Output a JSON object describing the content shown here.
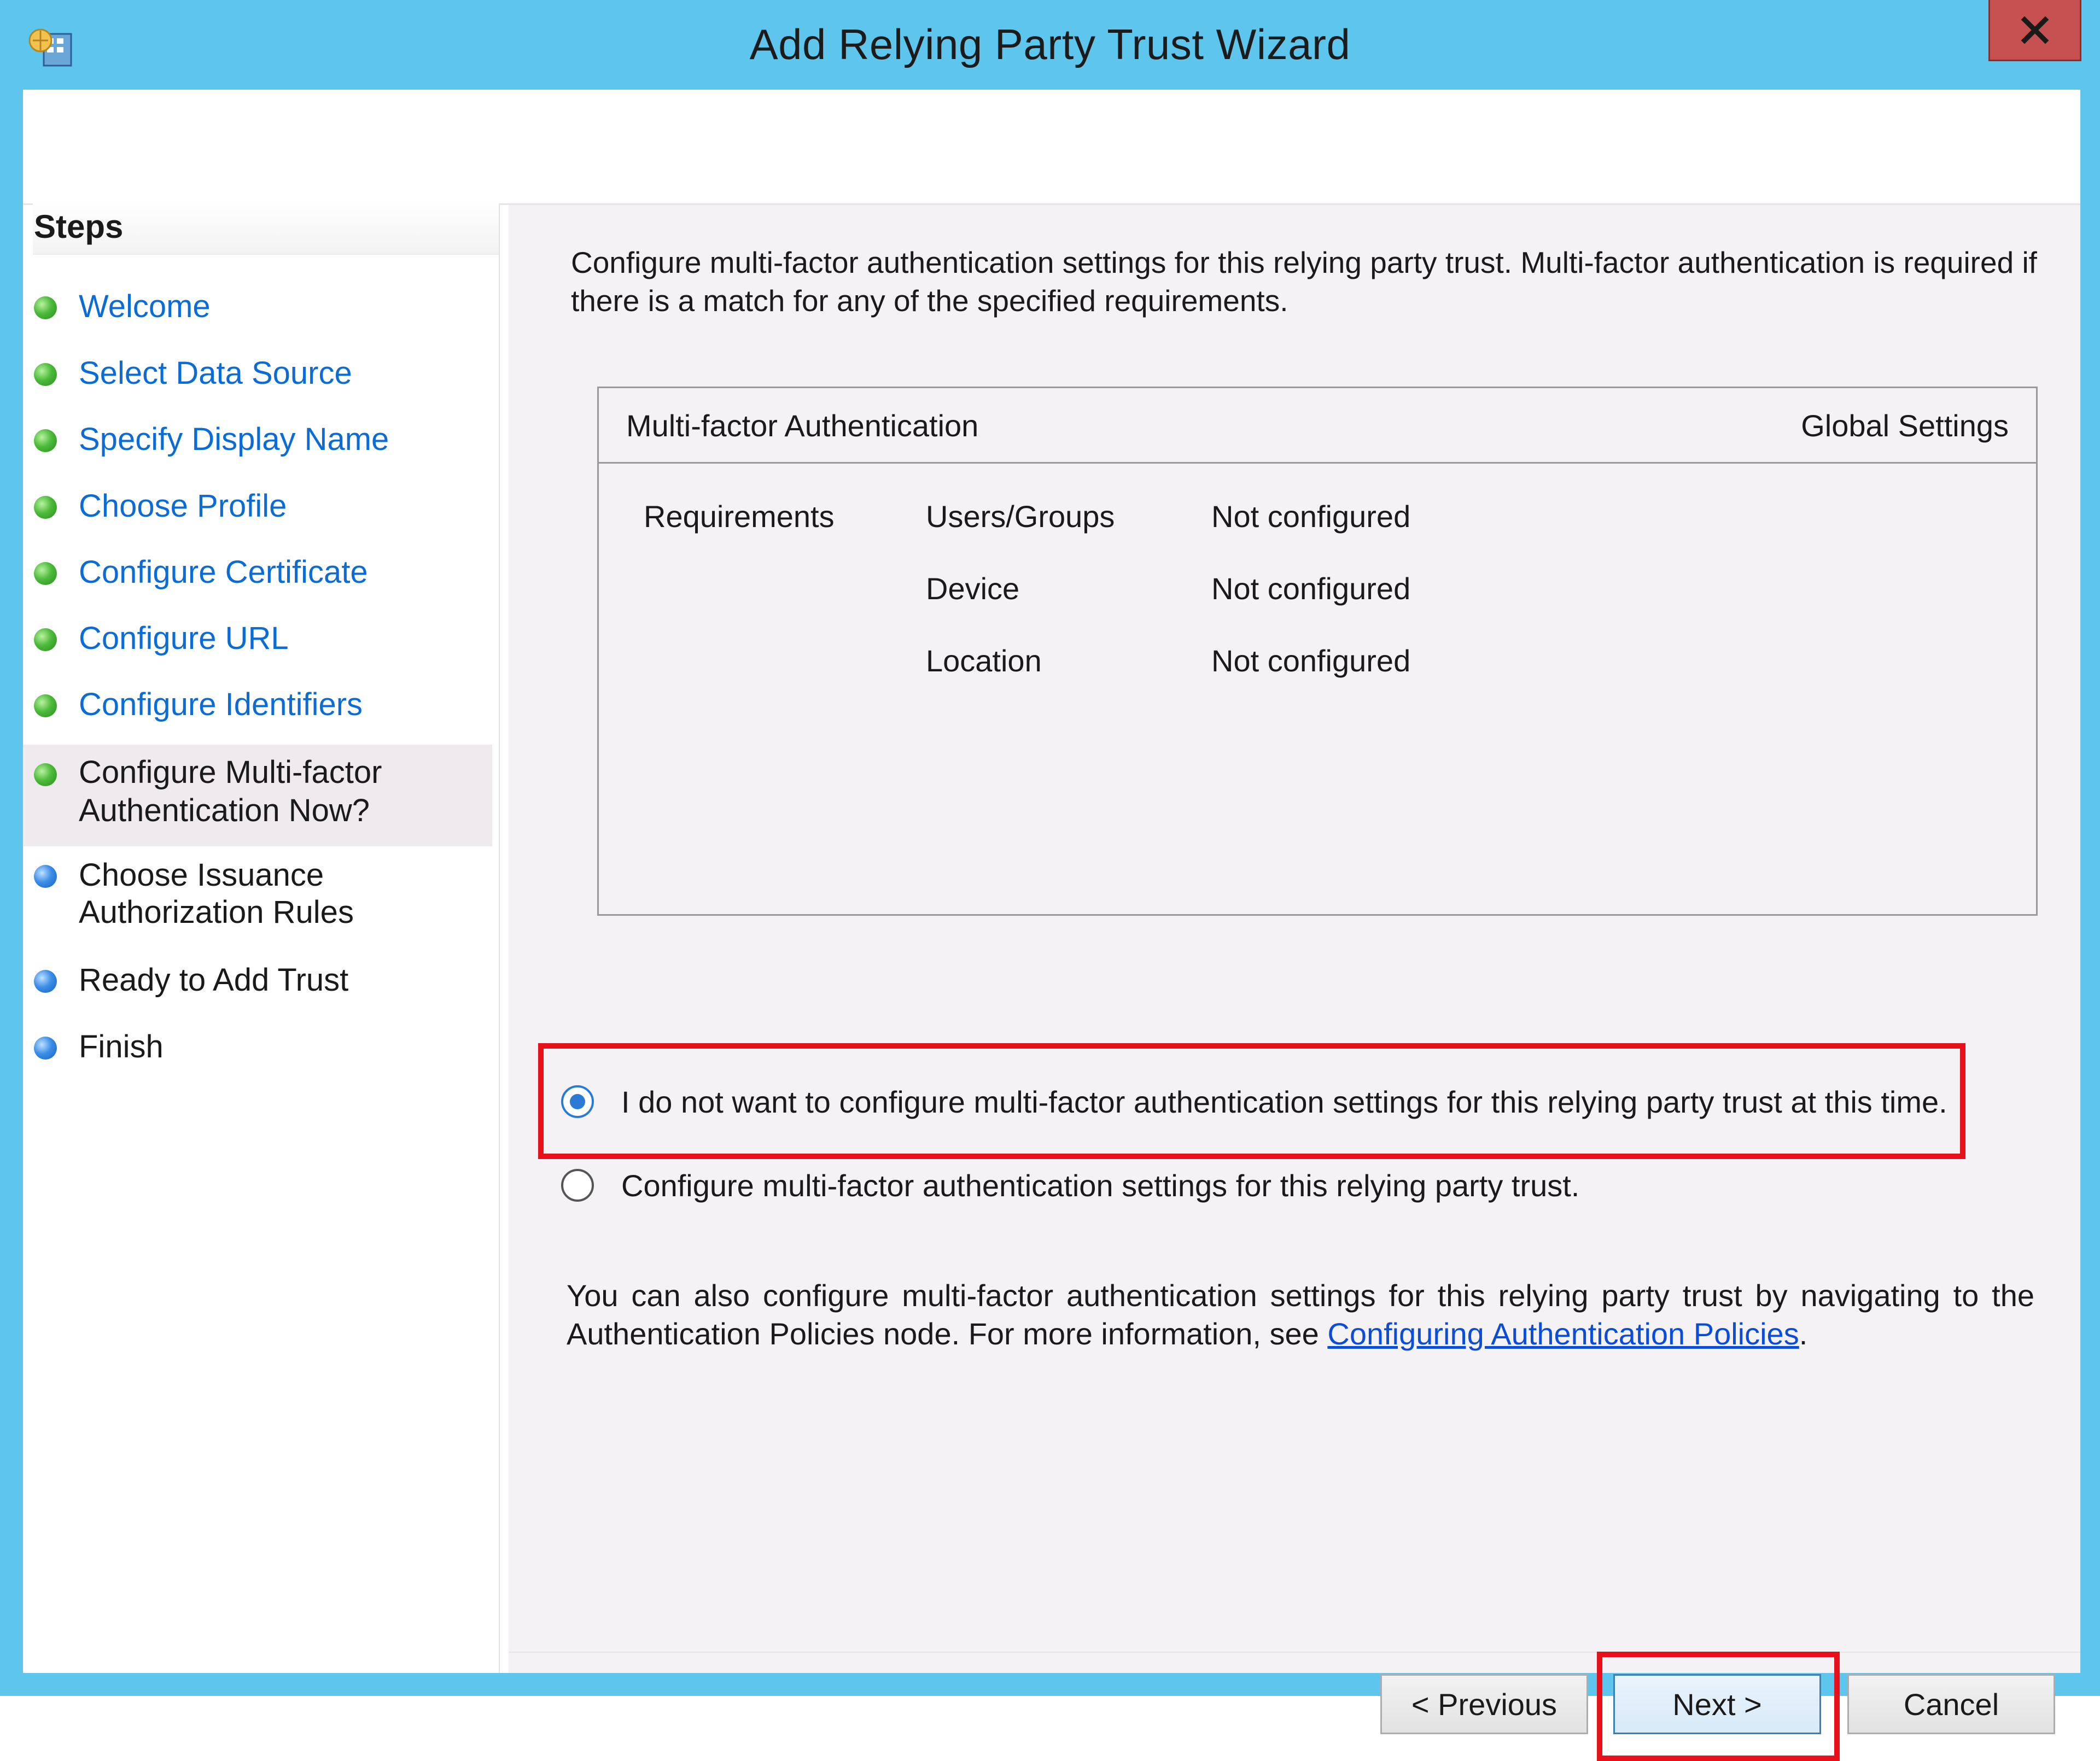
{
  "window": {
    "title": "Add Relying Party Trust Wizard",
    "close_label": "x"
  },
  "steps": {
    "heading": "Steps",
    "items": [
      {
        "label": "Welcome",
        "status": "done"
      },
      {
        "label": "Select Data Source",
        "status": "done"
      },
      {
        "label": "Specify Display Name",
        "status": "done"
      },
      {
        "label": "Choose Profile",
        "status": "done"
      },
      {
        "label": "Configure Certificate",
        "status": "done"
      },
      {
        "label": "Configure URL",
        "status": "done"
      },
      {
        "label": "Configure Identifiers",
        "status": "done"
      },
      {
        "label": "Configure Multi-factor",
        "label2": "Authentication Now?",
        "status": "current"
      },
      {
        "label": "Choose Issuance",
        "label2": "Authorization Rules",
        "status": "todo"
      },
      {
        "label": "Ready to Add Trust",
        "status": "todo"
      },
      {
        "label": "Finish",
        "status": "todo"
      }
    ]
  },
  "content": {
    "intro_line1": "Configure multi-factor authentication settings for this relying party trust. Multi-factor authentication is required if",
    "intro_line2": "there is a match for any of the specified requirements.",
    "mfa_panel": {
      "title": "Multi-factor Authentication",
      "scope": "Global Settings",
      "requirements_label": "Requirements",
      "rows": [
        {
          "name": "Users/Groups",
          "value": "Not configured"
        },
        {
          "name": "Device",
          "value": "Not configured"
        },
        {
          "name": "Location",
          "value": "Not configured"
        }
      ]
    },
    "radio_no": "I do not want to configure multi-factor authentication settings for this relying party trust at this time.",
    "radio_yes": "Configure multi-factor authentication settings for this relying party trust.",
    "note_text": "You can also configure multi-factor authentication settings for this relying party trust by navigating to the Authentication Policies node. For more information, see ",
    "note_link": "Configuring Authentication Policies",
    "note_end": "."
  },
  "buttons": {
    "previous": "< Previous",
    "next": "Next >",
    "cancel": "Cancel"
  },
  "colors": {
    "titlebar": "#5ec5ec",
    "close": "#c75050",
    "link": "#0b6cd6",
    "highlight": "#e8101a",
    "done_dot": "#4cbb3a",
    "todo_dot": "#3a8ee8"
  }
}
